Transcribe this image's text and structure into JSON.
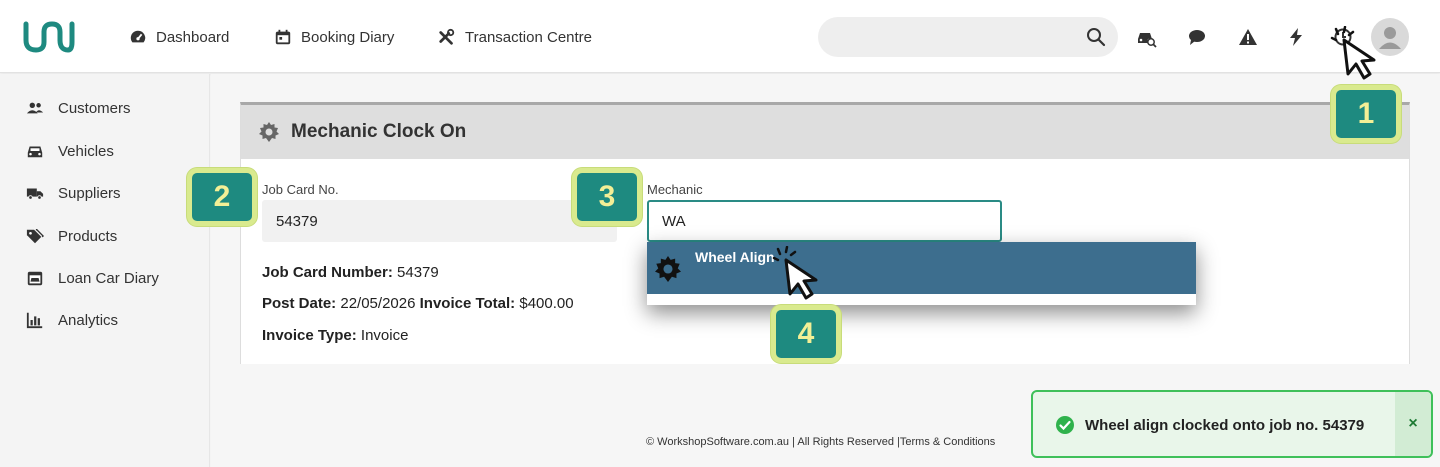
{
  "nav": {
    "items": [
      {
        "label": "Dashboard",
        "icon": "dashboard-icon"
      },
      {
        "label": "Booking Diary",
        "icon": "calendar-icon"
      },
      {
        "label": "Transaction Centre",
        "icon": "tools-icon"
      }
    ],
    "search_value": ""
  },
  "sidebar": {
    "items": [
      {
        "label": "Customers",
        "icon": "users-icon"
      },
      {
        "label": "Vehicles",
        "icon": "car-icon"
      },
      {
        "label": "Suppliers",
        "icon": "truck-icon"
      },
      {
        "label": "Products",
        "icon": "tags-icon"
      },
      {
        "label": "Loan Car Diary",
        "icon": "calendar-car-icon"
      },
      {
        "label": "Analytics",
        "icon": "chart-icon"
      }
    ]
  },
  "card": {
    "title": "Mechanic Clock On",
    "job_card_label": "Job Card No.",
    "job_card_value": "54379",
    "mechanic_label": "Mechanic",
    "mechanic_value": "WA",
    "dropdown_option": "Wheel Align",
    "info": {
      "job_card_number_label": "Job Card Number:",
      "job_card_number_value": "54379",
      "post_date_label": "Post Date:",
      "post_date_value": "22/05/2026",
      "invoice_total_label": "Invoice Total:",
      "invoice_total_value": "$400.00",
      "invoice_type_label": "Invoice Type:",
      "invoice_type_value": "Invoice"
    }
  },
  "footer": "© WorkshopSoftware.com.au | All Rights Reserved |Terms & Conditions",
  "toast": {
    "message": "Wheel align clocked onto job no. 54379",
    "close": "×"
  },
  "steps": [
    "1",
    "2",
    "3",
    "4"
  ],
  "colors": {
    "brand": "#1e8a80",
    "dropdown_highlight": "#3d6e8e",
    "input_focus": "#2a8b85",
    "toast_border": "#3fc05a",
    "badge_border": "#d9ea8e"
  }
}
